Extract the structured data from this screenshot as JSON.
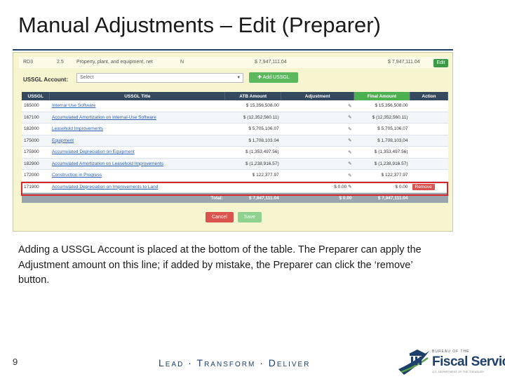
{
  "slide": {
    "title": "Manual Adjustments – Edit (Preparer)",
    "caption": "Adding a USSGL Account is placed at the bottom of the table.  The Preparer can apply the Adjustment amount on this line; if added by mistake, the Preparer can click the ‘remove’ button.",
    "page_number": "9",
    "footer_tagline": "Lead · Transform · Deliver",
    "logo": {
      "top_text": "BUREAU OF THE",
      "name": "Fiscal Service",
      "sub_text": "U.S. DEPARTMENT OF THE TREASURY"
    }
  },
  "screenshot": {
    "header_row": {
      "code": "RD3",
      "num": "2.5",
      "line_item": "Property, plant, and equipment, net",
      "flag": "N",
      "amount_1": "$ 7,947,111.04",
      "amount_2": "$ 7,947,111.04",
      "edit_label": "Edit"
    },
    "account_label": "USSGL Account:",
    "select_placeholder": "Select",
    "add_button_label": "Add USSGL",
    "columns": [
      "USSGL",
      "USSGL Title",
      "ATB Amount",
      "Adjustment",
      "Final Amount",
      "Action"
    ],
    "rows": [
      {
        "ussgl": "165000",
        "title": "Internal Use Software",
        "atb": "$ 15,356,508.00",
        "adjustment": "",
        "final": "$ 15,356,508.00"
      },
      {
        "ussgl": "167100",
        "title": "Accumulated Amortization on Internal-Use Software",
        "atb": "$ (12,352,560.11)",
        "adjustment": "",
        "final": "$ (12,352,560.11)"
      },
      {
        "ussgl": "182000",
        "title": "Leasehold Improvements",
        "atb": "$ 5,705,106.07",
        "adjustment": "",
        "final": "$ 5,705,106.07"
      },
      {
        "ussgl": "175000",
        "title": "Equipment",
        "atb": "$ 1,708,103.04",
        "adjustment": "",
        "final": "$ 1,708,103.04"
      },
      {
        "ussgl": "175900",
        "title": "Accumulated Depreciation on Equipment",
        "atb": "$ (1,353,497.56)",
        "adjustment": "",
        "final": "$ (1,353,497.56)"
      },
      {
        "ussgl": "182900",
        "title": "Accumulated Amortization on Leasehold Improvements",
        "atb": "$ (1,238,916.57)",
        "adjustment": "",
        "final": "$ (1,238,916.57)"
      },
      {
        "ussgl": "172000",
        "title": "Construction in Progress",
        "atb": "$ 122,377.97",
        "adjustment": "",
        "final": "$ 122,377.97"
      }
    ],
    "new_row": {
      "ussgl": "171900",
      "title": "Accumulated Depreciation on Improvements to Land",
      "atb": "",
      "adjustment": "$ 0.00",
      "final": "$ 0.00",
      "remove_label": "Remove"
    },
    "totals": {
      "label": "Total:",
      "atb": "$ 7,947,111.04",
      "adjustment": "$ 0.00",
      "final": "$ 7,947,111.04"
    },
    "cancel_label": "Cancel",
    "save_label": "Save"
  },
  "colors": {
    "header_dark": "#34495e",
    "final_header": "#4caf50",
    "highlight_red": "#d9262a",
    "remove_red": "#d9534f",
    "edit_green": "#3c9a47",
    "brand_navy": "#1f3f6b"
  },
  "icons": [
    "pencil-icon",
    "plus-icon",
    "chevron-down-icon",
    "treasury-building-icon"
  ]
}
